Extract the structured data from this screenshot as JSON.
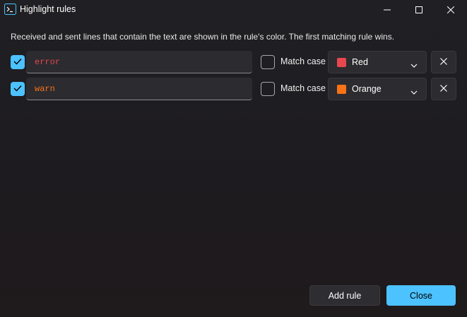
{
  "window": {
    "title": "Highlight rules"
  },
  "description": "Received and sent lines that contain the text are shown in the rule's color. The first matching rule wins.",
  "rules": [
    {
      "enabled": true,
      "pattern": "error",
      "match_case_label": "Match case",
      "match_case": false,
      "color_name": "Red",
      "color_hex": "#e8474f"
    },
    {
      "enabled": true,
      "pattern": "warn",
      "match_case_label": "Match case",
      "match_case": false,
      "color_name": "Orange",
      "color_hex": "#f97316"
    }
  ],
  "footer": {
    "add_label": "Add rule",
    "close_label": "Close"
  },
  "theme": {
    "accent": "#4cc2ff"
  }
}
